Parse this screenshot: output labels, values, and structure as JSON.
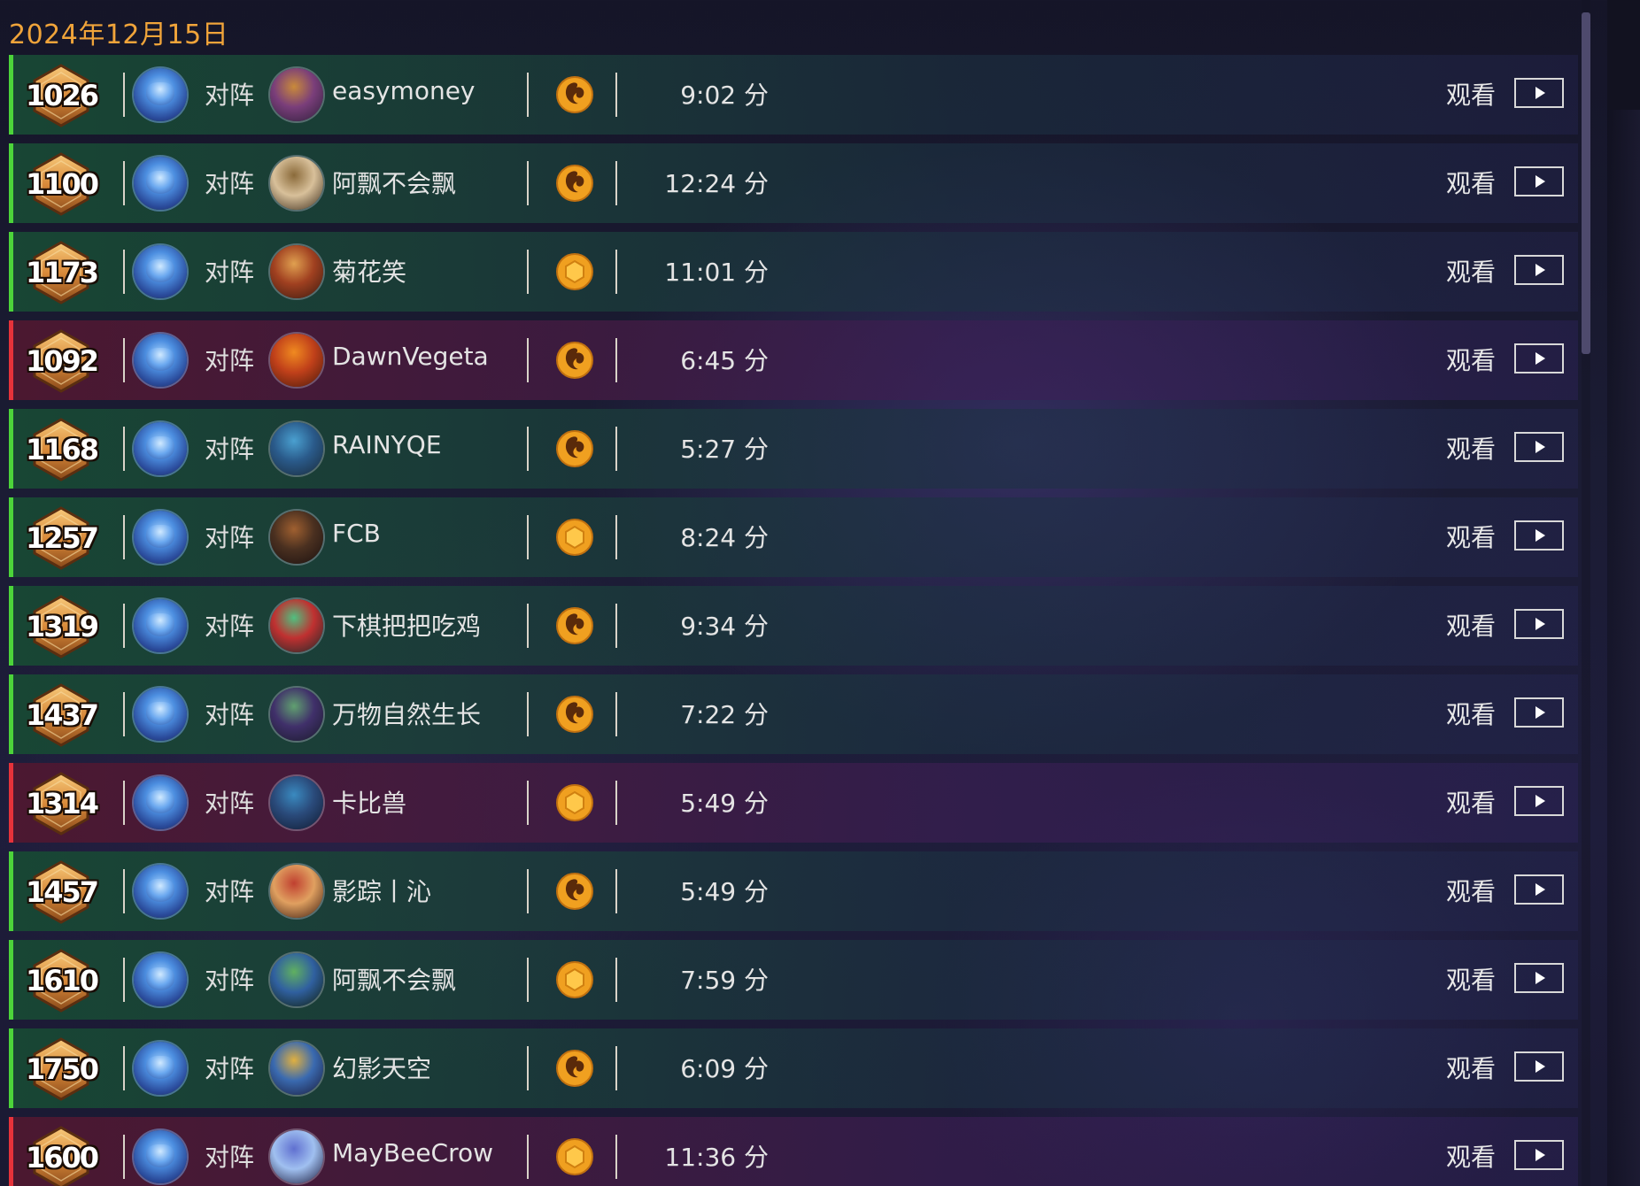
{
  "date_header": "2024年12月15日",
  "vs_label": "对阵",
  "watch_label": "观看",
  "colors": {
    "win": "#4cd43a",
    "loss": "#e6323a",
    "date": "#f0a43a",
    "mode_icon": "#f0a020"
  },
  "matches": [
    {
      "rank": "1026",
      "result": "win",
      "opponent": "easymoney",
      "opponent_avatar": "opponent-hero-portrait",
      "mode_icon": "fire-swirl-icon",
      "duration": "9:02 分"
    },
    {
      "rank": "1100",
      "result": "win",
      "opponent": "阿飘不会飘",
      "opponent_avatar": "opponent-hero-portrait",
      "mode_icon": "fire-swirl-icon",
      "duration": "12:24 分"
    },
    {
      "rank": "1173",
      "result": "win",
      "opponent": "菊花笑",
      "opponent_avatar": "opponent-hero-portrait",
      "mode_icon": "hexagon-coin-icon",
      "duration": "11:01 分"
    },
    {
      "rank": "1092",
      "result": "loss",
      "opponent": "DawnVegeta",
      "opponent_avatar": "opponent-hero-portrait",
      "mode_icon": "fire-swirl-icon",
      "duration": "6:45 分"
    },
    {
      "rank": "1168",
      "result": "win",
      "opponent": "RAINYQE",
      "opponent_avatar": "opponent-hero-portrait",
      "mode_icon": "fire-swirl-icon",
      "duration": "5:27 分"
    },
    {
      "rank": "1257",
      "result": "win",
      "opponent": "FCB",
      "opponent_avatar": "opponent-hero-portrait",
      "mode_icon": "hexagon-coin-icon",
      "duration": "8:24 分"
    },
    {
      "rank": "1319",
      "result": "win",
      "opponent": "下棋把把吃鸡",
      "opponent_avatar": "opponent-hero-portrait",
      "mode_icon": "fire-swirl-icon",
      "duration": "9:34 分"
    },
    {
      "rank": "1437",
      "result": "win",
      "opponent": "万物自然生长",
      "opponent_avatar": "opponent-hero-portrait",
      "mode_icon": "fire-swirl-icon",
      "duration": "7:22 分"
    },
    {
      "rank": "1314",
      "result": "loss",
      "opponent": "卡比兽",
      "opponent_avatar": "opponent-hero-portrait",
      "mode_icon": "hexagon-coin-icon",
      "duration": "5:49 分"
    },
    {
      "rank": "1457",
      "result": "win",
      "opponent": "影踪丨沁",
      "opponent_avatar": "opponent-hero-portrait",
      "mode_icon": "fire-swirl-icon",
      "duration": "5:49 分"
    },
    {
      "rank": "1610",
      "result": "win",
      "opponent": "阿飘不会飘",
      "opponent_avatar": "opponent-hero-portrait",
      "mode_icon": "hexagon-coin-icon",
      "duration": "7:59 分"
    },
    {
      "rank": "1750",
      "result": "win",
      "opponent": "幻影天空",
      "opponent_avatar": "opponent-hero-portrait",
      "mode_icon": "fire-swirl-icon",
      "duration": "6:09 分"
    },
    {
      "rank": "1600",
      "result": "loss",
      "opponent": "MayBeeCrow",
      "opponent_avatar": "opponent-hero-portrait",
      "mode_icon": "hexagon-coin-icon",
      "duration": "11:36 分"
    }
  ]
}
